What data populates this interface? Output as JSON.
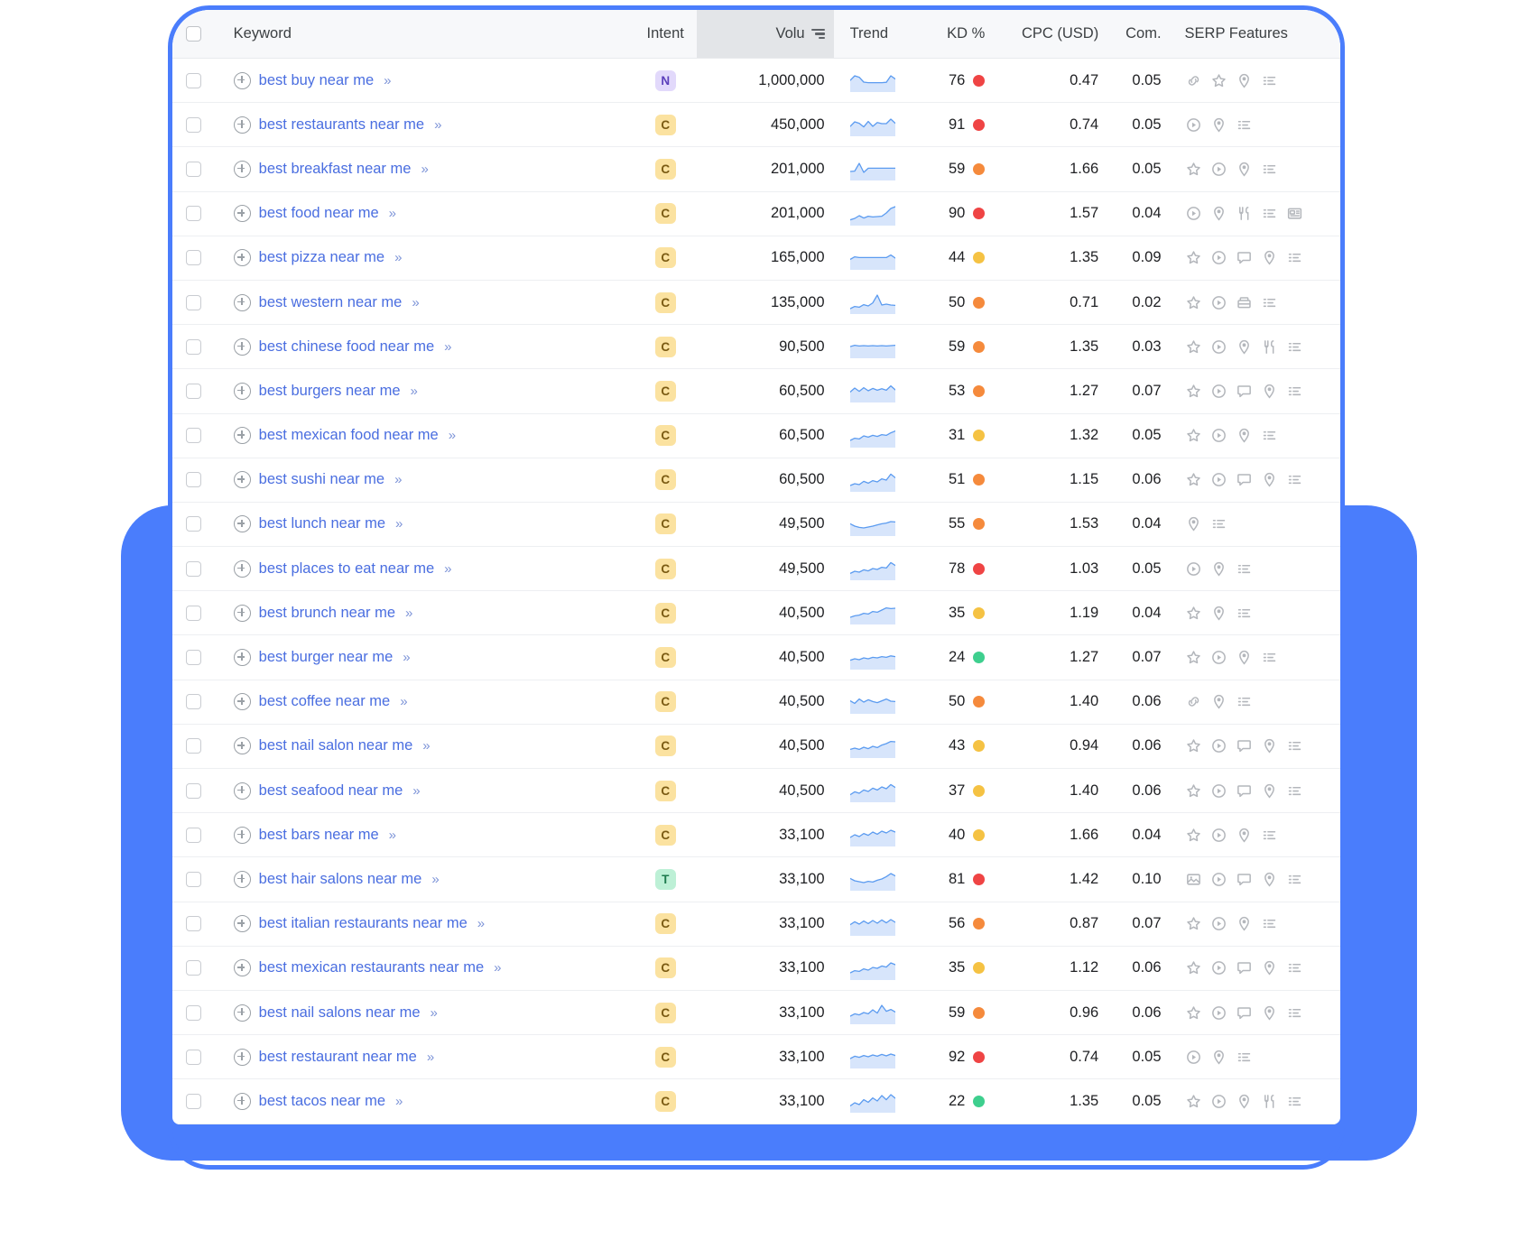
{
  "table": {
    "columns": [
      {
        "key": "checkbox",
        "label": ""
      },
      {
        "key": "keyword",
        "label": "Keyword"
      },
      {
        "key": "intent",
        "label": "Intent"
      },
      {
        "key": "volume",
        "label": "Volu",
        "sorted": true,
        "sort_icon": "sort-descending-icon"
      },
      {
        "key": "trend",
        "label": "Trend"
      },
      {
        "key": "kd",
        "label": "KD %"
      },
      {
        "key": "cpc",
        "label": "CPC (USD)"
      },
      {
        "key": "com",
        "label": "Com."
      },
      {
        "key": "serp",
        "label": "SERP Features"
      }
    ],
    "row_icons": {
      "add_keyword": "plus-circle-icon",
      "expand": "double-chevron-right-icon"
    },
    "kd_colors": {
      "green": "#3ecf8e",
      "yellow": "#f5c243",
      "orange": "#f58a3c",
      "red": "#ef4444"
    },
    "intent_colors": {
      "C": "#fbe2a0",
      "N": "#e2d9fb",
      "T": "#bdf0d6",
      "I": "#bfe3fb"
    },
    "accent_blue": "#4a7dfc",
    "link_blue": "#4a6ee0",
    "rows": [
      {
        "keyword": "best buy near me",
        "intent": "N",
        "volume": "1,000,000",
        "kd": "76",
        "kd_color": "red",
        "cpc": "0.47",
        "com": "0.05",
        "trend": [
          0.55,
          0.8,
          0.72,
          0.45,
          0.42,
          0.42,
          0.42,
          0.42,
          0.44,
          0.8,
          0.62
        ],
        "serp": [
          "link-icon",
          "star-icon",
          "map-pin-icon",
          "list-icon"
        ]
      },
      {
        "keyword": "best restaurants near me",
        "intent": "C",
        "volume": "450,000",
        "kd": "91",
        "kd_color": "red",
        "cpc": "0.74",
        "com": "0.05",
        "trend": [
          0.45,
          0.7,
          0.62,
          0.42,
          0.72,
          0.45,
          0.66,
          0.6,
          0.6,
          0.85,
          0.62
        ],
        "serp": [
          "play-circle-icon",
          "map-pin-icon",
          "list-icon"
        ]
      },
      {
        "keyword": "best breakfast near me",
        "intent": "C",
        "volume": "201,000",
        "kd": "59",
        "kd_color": "orange",
        "cpc": "1.66",
        "com": "0.05",
        "trend": [
          0.4,
          0.42,
          0.85,
          0.35,
          0.58,
          0.58,
          0.58,
          0.58,
          0.58,
          0.58,
          0.58
        ],
        "serp": [
          "star-icon",
          "play-circle-icon",
          "map-pin-icon",
          "list-icon"
        ]
      },
      {
        "keyword": "best food near me",
        "intent": "C",
        "volume": "201,000",
        "kd": "90",
        "kd_color": "red",
        "cpc": "1.57",
        "com": "0.04",
        "trend": [
          0.22,
          0.3,
          0.45,
          0.32,
          0.42,
          0.38,
          0.4,
          0.42,
          0.6,
          0.85,
          0.95
        ],
        "serp": [
          "play-circle-icon",
          "map-pin-icon",
          "restaurant-icon",
          "list-icon",
          "news-icon"
        ]
      },
      {
        "keyword": "best pizza near me",
        "intent": "C",
        "volume": "165,000",
        "kd": "44",
        "kd_color": "yellow",
        "cpc": "1.35",
        "com": "0.09",
        "trend": [
          0.48,
          0.62,
          0.58,
          0.58,
          0.58,
          0.58,
          0.58,
          0.58,
          0.58,
          0.72,
          0.55
        ],
        "serp": [
          "star-icon",
          "play-circle-icon",
          "review-icon",
          "map-pin-icon",
          "list-icon"
        ]
      },
      {
        "keyword": "best western near me",
        "intent": "C",
        "volume": "135,000",
        "kd": "50",
        "kd_color": "orange",
        "cpc": "0.71",
        "com": "0.02",
        "trend": [
          0.2,
          0.32,
          0.28,
          0.42,
          0.35,
          0.52,
          0.95,
          0.4,
          0.45,
          0.4,
          0.38
        ],
        "serp": [
          "star-icon",
          "play-circle-icon",
          "hotel-icon",
          "list-icon"
        ]
      },
      {
        "keyword": "best chinese food near me",
        "intent": "C",
        "volume": "90,500",
        "kd": "59",
        "kd_color": "orange",
        "cpc": "1.35",
        "com": "0.03",
        "trend": [
          0.55,
          0.62,
          0.58,
          0.6,
          0.58,
          0.6,
          0.58,
          0.6,
          0.58,
          0.6,
          0.62
        ],
        "serp": [
          "star-icon",
          "play-circle-icon",
          "map-pin-icon",
          "restaurant-icon",
          "list-icon"
        ]
      },
      {
        "keyword": "best burgers near me",
        "intent": "C",
        "volume": "60,500",
        "kd": "53",
        "kd_color": "orange",
        "cpc": "1.27",
        "com": "0.07",
        "trend": [
          0.48,
          0.7,
          0.52,
          0.72,
          0.55,
          0.68,
          0.58,
          0.66,
          0.58,
          0.82,
          0.6
        ],
        "serp": [
          "star-icon",
          "play-circle-icon",
          "review-icon",
          "map-pin-icon",
          "list-icon"
        ]
      },
      {
        "keyword": "best mexican food near me",
        "intent": "C",
        "volume": "60,500",
        "kd": "31",
        "kd_color": "yellow",
        "cpc": "1.32",
        "com": "0.05",
        "trend": [
          0.3,
          0.42,
          0.38,
          0.55,
          0.48,
          0.58,
          0.52,
          0.62,
          0.58,
          0.72,
          0.82
        ],
        "serp": [
          "star-icon",
          "play-circle-icon",
          "map-pin-icon",
          "list-icon"
        ]
      },
      {
        "keyword": "best sushi near me",
        "intent": "C",
        "volume": "60,500",
        "kd": "51",
        "kd_color": "orange",
        "cpc": "1.15",
        "com": "0.06",
        "trend": [
          0.25,
          0.35,
          0.3,
          0.48,
          0.38,
          0.52,
          0.45,
          0.62,
          0.55,
          0.88,
          0.68
        ],
        "serp": [
          "star-icon",
          "play-circle-icon",
          "review-icon",
          "map-pin-icon",
          "list-icon"
        ]
      },
      {
        "keyword": "best lunch near me",
        "intent": "C",
        "volume": "49,500",
        "kd": "55",
        "kd_color": "orange",
        "cpc": "1.53",
        "com": "0.04",
        "trend": [
          0.58,
          0.45,
          0.38,
          0.35,
          0.4,
          0.45,
          0.52,
          0.58,
          0.62,
          0.7,
          0.68
        ],
        "serp": [
          "map-pin-icon",
          "list-icon"
        ]
      },
      {
        "keyword": "best places to eat near me",
        "intent": "C",
        "volume": "49,500",
        "kd": "78",
        "kd_color": "red",
        "cpc": "1.03",
        "com": "0.05",
        "trend": [
          0.28,
          0.4,
          0.35,
          0.48,
          0.42,
          0.55,
          0.5,
          0.62,
          0.58,
          0.88,
          0.72
        ],
        "serp": [
          "play-circle-icon",
          "map-pin-icon",
          "list-icon"
        ]
      },
      {
        "keyword": "best brunch near me",
        "intent": "C",
        "volume": "40,500",
        "kd": "35",
        "kd_color": "yellow",
        "cpc": "1.19",
        "com": "0.04",
        "trend": [
          0.3,
          0.38,
          0.42,
          0.52,
          0.48,
          0.62,
          0.58,
          0.7,
          0.82,
          0.78,
          0.8
        ],
        "serp": [
          "star-icon",
          "map-pin-icon",
          "list-icon"
        ]
      },
      {
        "keyword": "best burger near me",
        "intent": "C",
        "volume": "40,500",
        "kd": "24",
        "kd_color": "green",
        "cpc": "1.27",
        "com": "0.07",
        "trend": [
          0.42,
          0.5,
          0.45,
          0.55,
          0.5,
          0.58,
          0.55,
          0.62,
          0.58,
          0.66,
          0.62
        ],
        "serp": [
          "star-icon",
          "play-circle-icon",
          "map-pin-icon",
          "list-icon"
        ]
      },
      {
        "keyword": "best coffee near me",
        "intent": "C",
        "volume": "40,500",
        "kd": "50",
        "kd_color": "orange",
        "cpc": "1.40",
        "com": "0.06",
        "trend": [
          0.62,
          0.48,
          0.72,
          0.55,
          0.68,
          0.58,
          0.52,
          0.62,
          0.72,
          0.6,
          0.58
        ],
        "serp": [
          "link-icon",
          "map-pin-icon",
          "list-icon"
        ]
      },
      {
        "keyword": "best nail salon near me",
        "intent": "C",
        "volume": "40,500",
        "kd": "43",
        "kd_color": "yellow",
        "cpc": "0.94",
        "com": "0.06",
        "trend": [
          0.38,
          0.45,
          0.38,
          0.5,
          0.42,
          0.55,
          0.48,
          0.62,
          0.7,
          0.82,
          0.8
        ],
        "serp": [
          "star-icon",
          "play-circle-icon",
          "review-icon",
          "map-pin-icon",
          "list-icon"
        ]
      },
      {
        "keyword": "best seafood near me",
        "intent": "C",
        "volume": "40,500",
        "kd": "37",
        "kd_color": "yellow",
        "cpc": "1.40",
        "com": "0.06",
        "trend": [
          0.32,
          0.48,
          0.4,
          0.58,
          0.5,
          0.68,
          0.58,
          0.75,
          0.65,
          0.88,
          0.72
        ],
        "serp": [
          "star-icon",
          "play-circle-icon",
          "review-icon",
          "map-pin-icon",
          "list-icon"
        ]
      },
      {
        "keyword": "best bars near me",
        "intent": "C",
        "volume": "33,100",
        "kd": "40",
        "kd_color": "yellow",
        "cpc": "1.66",
        "com": "0.04",
        "trend": [
          0.4,
          0.55,
          0.45,
          0.62,
          0.52,
          0.7,
          0.58,
          0.75,
          0.65,
          0.8,
          0.7
        ],
        "serp": [
          "star-icon",
          "play-circle-icon",
          "map-pin-icon",
          "list-icon"
        ]
      },
      {
        "keyword": "best hair salons near me",
        "intent": "T",
        "volume": "33,100",
        "kd": "81",
        "kd_color": "red",
        "cpc": "1.42",
        "com": "0.10",
        "trend": [
          0.58,
          0.45,
          0.4,
          0.35,
          0.42,
          0.38,
          0.48,
          0.55,
          0.68,
          0.85,
          0.72
        ],
        "serp": [
          "image-icon",
          "play-circle-icon",
          "review-icon",
          "map-pin-icon",
          "list-icon"
        ]
      },
      {
        "keyword": "best italian restaurants near me",
        "intent": "C",
        "volume": "33,100",
        "kd": "56",
        "kd_color": "orange",
        "cpc": "0.87",
        "com": "0.07",
        "trend": [
          0.52,
          0.68,
          0.55,
          0.72,
          0.58,
          0.75,
          0.6,
          0.78,
          0.62,
          0.8,
          0.65
        ],
        "serp": [
          "star-icon",
          "play-circle-icon",
          "map-pin-icon",
          "list-icon"
        ]
      },
      {
        "keyword": "best mexican restaurants near me",
        "intent": "C",
        "volume": "33,100",
        "kd": "35",
        "kd_color": "yellow",
        "cpc": "1.12",
        "com": "0.06",
        "trend": [
          0.3,
          0.42,
          0.38,
          0.52,
          0.45,
          0.6,
          0.55,
          0.68,
          0.62,
          0.85,
          0.75
        ],
        "serp": [
          "star-icon",
          "play-circle-icon",
          "review-icon",
          "map-pin-icon",
          "list-icon"
        ]
      },
      {
        "keyword": "best nail salons near me",
        "intent": "C",
        "volume": "33,100",
        "kd": "59",
        "kd_color": "orange",
        "cpc": "0.96",
        "com": "0.06",
        "trend": [
          0.35,
          0.48,
          0.42,
          0.55,
          0.48,
          0.7,
          0.52,
          0.95,
          0.62,
          0.72,
          0.58
        ],
        "serp": [
          "star-icon",
          "play-circle-icon",
          "review-icon",
          "map-pin-icon",
          "list-icon"
        ]
      },
      {
        "keyword": "best restaurant near me",
        "intent": "C",
        "volume": "33,100",
        "kd": "92",
        "kd_color": "red",
        "cpc": "0.74",
        "com": "0.05",
        "trend": [
          0.45,
          0.58,
          0.52,
          0.62,
          0.55,
          0.65,
          0.58,
          0.68,
          0.6,
          0.7,
          0.62
        ],
        "serp": [
          "play-circle-icon",
          "map-pin-icon",
          "list-icon"
        ]
      },
      {
        "keyword": "best tacos near me",
        "intent": "C",
        "volume": "33,100",
        "kd": "22",
        "kd_color": "green",
        "cpc": "1.35",
        "com": "0.05",
        "trend": [
          0.28,
          0.45,
          0.35,
          0.62,
          0.48,
          0.72,
          0.55,
          0.85,
          0.62,
          0.9,
          0.7
        ],
        "serp": [
          "star-icon",
          "play-circle-icon",
          "map-pin-icon",
          "restaurant-icon",
          "list-icon"
        ]
      }
    ]
  }
}
